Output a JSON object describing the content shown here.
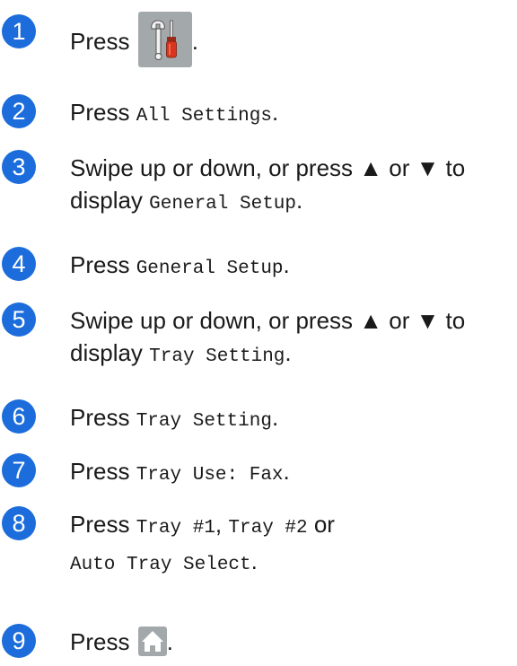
{
  "accent_color": "#1c6ddb",
  "icons": {
    "settings": "settings-tools-icon",
    "home": "home-icon"
  },
  "steps": [
    {
      "number": "1",
      "prefix": "Press",
      "suffix": "."
    },
    {
      "number": "2",
      "prefix": "Press",
      "code": "All Settings",
      "suffix": "."
    },
    {
      "number": "3",
      "line1": "Swipe up or down, or press ▲ or ▼ to",
      "prefix": "display",
      "code": "General Setup",
      "suffix": "."
    },
    {
      "number": "4",
      "prefix": "Press",
      "code": "General Setup",
      "suffix": "."
    },
    {
      "number": "5",
      "line1": "Swipe up or down, or press ▲ or ▼ to",
      "prefix": "display",
      "code": "Tray Setting",
      "suffix": "."
    },
    {
      "number": "6",
      "prefix": "Press",
      "code": "Tray Setting",
      "suffix": "."
    },
    {
      "number": "7",
      "prefix": "Press",
      "code": "Tray Use: Fax",
      "suffix": "."
    },
    {
      "number": "8",
      "prefix": "Press",
      "code1": "Tray #1",
      "sep1": ",",
      "code2": "Tray #2",
      "or": "or",
      "code3": "Auto Tray Select",
      "suffix": "."
    },
    {
      "number": "9",
      "prefix": "Press",
      "suffix": "."
    }
  ]
}
